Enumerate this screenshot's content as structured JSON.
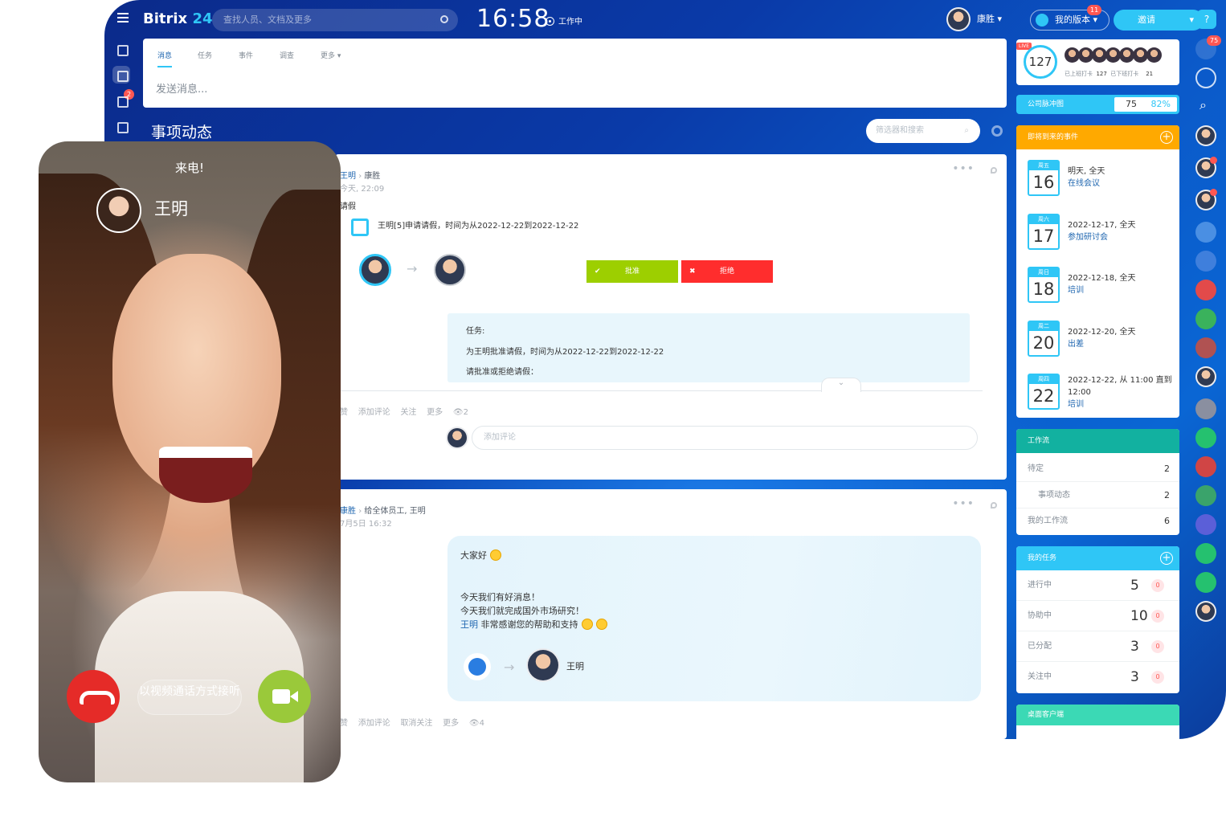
{
  "header": {
    "logo_main": "Bitrix",
    "logo_num": "24",
    "search_placeholder": "查找人员、文档及更多",
    "clock": "16:58",
    "work_status": "工作中",
    "user_name": "康胜",
    "my_version": "我的版本",
    "my_version_badge": "11",
    "invite": "邀请",
    "help": "?"
  },
  "left_nav": {
    "chat_badge": "2"
  },
  "composer": {
    "tabs": [
      "消息",
      "任务",
      "事件",
      "调查",
      "更多"
    ],
    "placeholder": "发送消息..."
  },
  "feed": {
    "title": "事项动态",
    "filter_placeholder": "筛选器和搜索",
    "post1": {
      "author": "王明",
      "recipient": "康胜",
      "time": "今天, 22:09",
      "type": "请假",
      "summary": "王明[5]申请请假，时间为从2022-12-22到2022-12-22",
      "approve": "批准",
      "reject": "拒绝",
      "task_label": "任务:",
      "task_line1": "为王明批准请假，时间为从2022-12-22到2022-12-22",
      "task_line2": "请批准或拒绝请假：",
      "actions": [
        "赞",
        "添加评论",
        "关注",
        "更多"
      ],
      "views": "2",
      "comment_placeholder": "添加评论"
    },
    "post2": {
      "author": "康胜",
      "recipient": "给全体员工, 王明",
      "time": "7月5日 16:32",
      "line1": "大家好",
      "line2": "今天我们有好消息！",
      "line3": "今天我们就完成国外市场研究！",
      "mention": "王明",
      "line4": "非常感谢您的帮助和支持",
      "liked_by": "王明",
      "actions": [
        "赞",
        "添加评论",
        "取消关注",
        "更多"
      ],
      "views": "4"
    }
  },
  "right": {
    "live": {
      "tag": "LIVE",
      "count": "127",
      "label_in": "已上班打卡",
      "in_count": "127",
      "label_out": "已下班打卡",
      "out_count": "21"
    },
    "pulse": {
      "label": "公司脉冲图",
      "value": "75",
      "pct": "82%"
    },
    "events_title": "即将到来的事件",
    "events": [
      {
        "dow": "周五",
        "day": "16",
        "when": "明天, 全天",
        "title": "在线会议"
      },
      {
        "dow": "周六",
        "day": "17",
        "when": "2022-12-17, 全天",
        "title": "参加研讨会"
      },
      {
        "dow": "周日",
        "day": "18",
        "when": "2022-12-18, 全天",
        "title": "培训"
      },
      {
        "dow": "周二",
        "day": "20",
        "when": "2022-12-20, 全天",
        "title": "出差"
      },
      {
        "dow": "周四",
        "day": "22",
        "when": "2022-12-22, 从 11:00 直到 12:00",
        "title": "培训"
      }
    ],
    "workflow_title": "工作流",
    "workflow": [
      {
        "label": "待定",
        "value": "2"
      },
      {
        "label": "事项动态",
        "value": "2"
      },
      {
        "label": "我的工作流",
        "value": "6"
      }
    ],
    "tasks_title": "我的任务",
    "tasks": [
      {
        "label": "进行中",
        "value": "5",
        "extra": "0"
      },
      {
        "label": "协助中",
        "value": "10",
        "extra": "0"
      },
      {
        "label": "已分配",
        "value": "3",
        "extra": "0"
      },
      {
        "label": "关注中",
        "value": "3",
        "extra": "0"
      }
    ],
    "desktop_title": "桌面客户端"
  },
  "right_nav": {
    "notif_badge": "75"
  },
  "call": {
    "title": "来电!",
    "caller": "王明",
    "video_answer": "以视频通话方式接听"
  }
}
